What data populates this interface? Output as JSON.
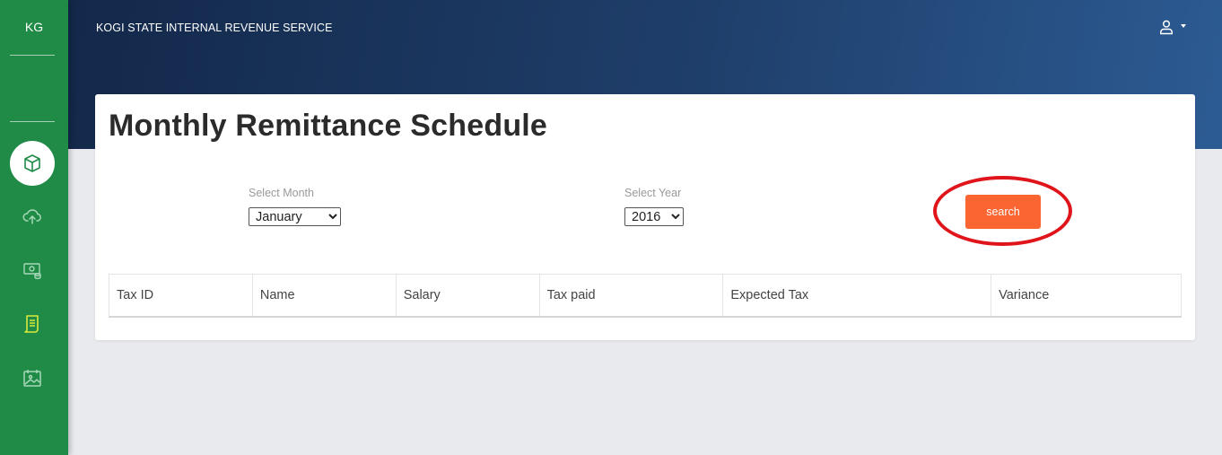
{
  "sidebar": {
    "brand": "KG",
    "items": [
      {
        "name": "box-icon",
        "active": true
      },
      {
        "name": "cloud-upload-icon",
        "active": false
      },
      {
        "name": "money-icon",
        "active": false
      },
      {
        "name": "receipt-icon",
        "active": false
      },
      {
        "name": "image-calendar-icon",
        "active": false
      }
    ]
  },
  "header": {
    "org_name": "KOGI STATE INTERNAL REVENUE SERVICE",
    "user_icon": "user-icon"
  },
  "main": {
    "title": "Monthly Remittance Schedule",
    "month": {
      "label": "Select Month",
      "selected": "January"
    },
    "year": {
      "label": "Select Year",
      "selected": "2016"
    },
    "search_label": "search",
    "table": {
      "columns": [
        "Tax ID",
        "Name",
        "Salary",
        "Tax paid",
        "Expected Tax",
        "Variance"
      ]
    }
  },
  "colors": {
    "sidebar_bg": "#1f8b47",
    "header_start": "#13284a",
    "header_end": "#2c5b93",
    "search_button": "#fb6531",
    "highlight_ring": "#e0141b",
    "active_nav_icon": "#1f8b47",
    "receipt_icon": "#d7ea3c"
  }
}
